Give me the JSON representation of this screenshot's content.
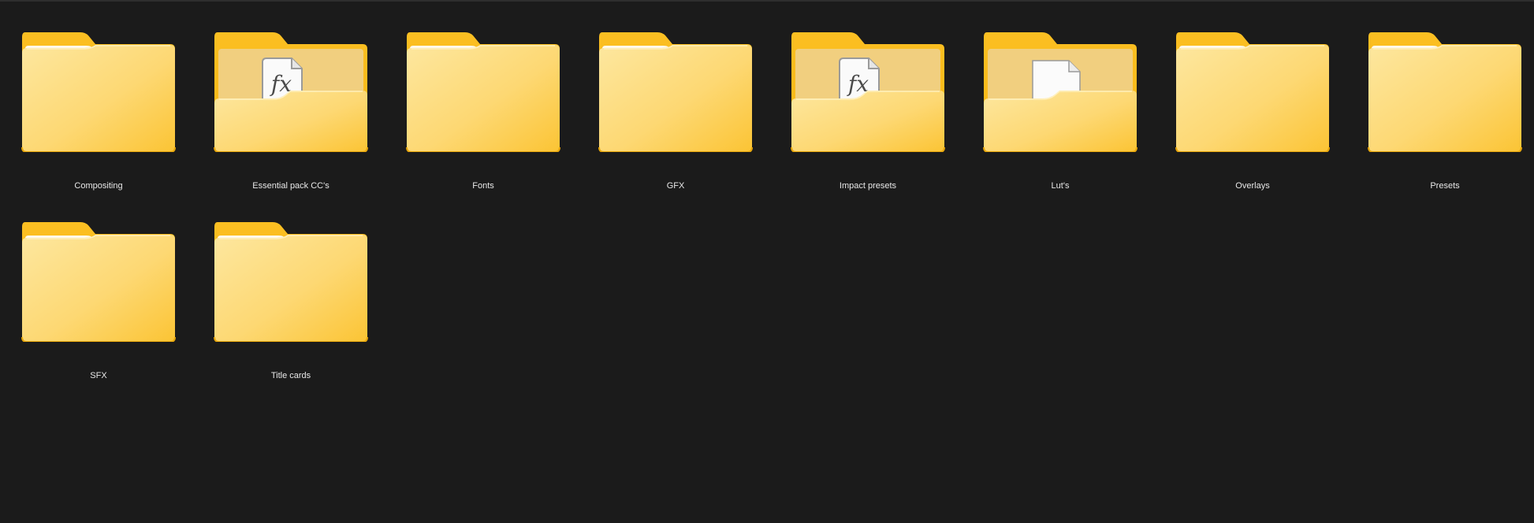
{
  "explorer": {
    "folders": [
      {
        "name": "Compositing",
        "content_icon": "none"
      },
      {
        "name": "Essential pack CC's",
        "content_icon": "fx-document-icon"
      },
      {
        "name": "Fonts",
        "content_icon": "none"
      },
      {
        "name": "GFX",
        "content_icon": "none"
      },
      {
        "name": "Impact presets",
        "content_icon": "fx-document-icon"
      },
      {
        "name": "Lut's",
        "content_icon": "blank-document-icon"
      },
      {
        "name": "Overlays",
        "content_icon": "none"
      },
      {
        "name": "Presets",
        "content_icon": "none"
      },
      {
        "name": "SFX",
        "content_icon": "none"
      },
      {
        "name": "Title cards",
        "content_icon": "none"
      }
    ]
  },
  "colors": {
    "background": "#1b1b1b",
    "folder_back": "#f9b714",
    "folder_front_light": "#fde79f",
    "folder_front_dark": "#fbc434",
    "label_text": "#e8e8e8"
  },
  "icon_names": {
    "folder": "folder-icon",
    "fx": "fx-document-icon",
    "blank": "blank-document-icon"
  }
}
